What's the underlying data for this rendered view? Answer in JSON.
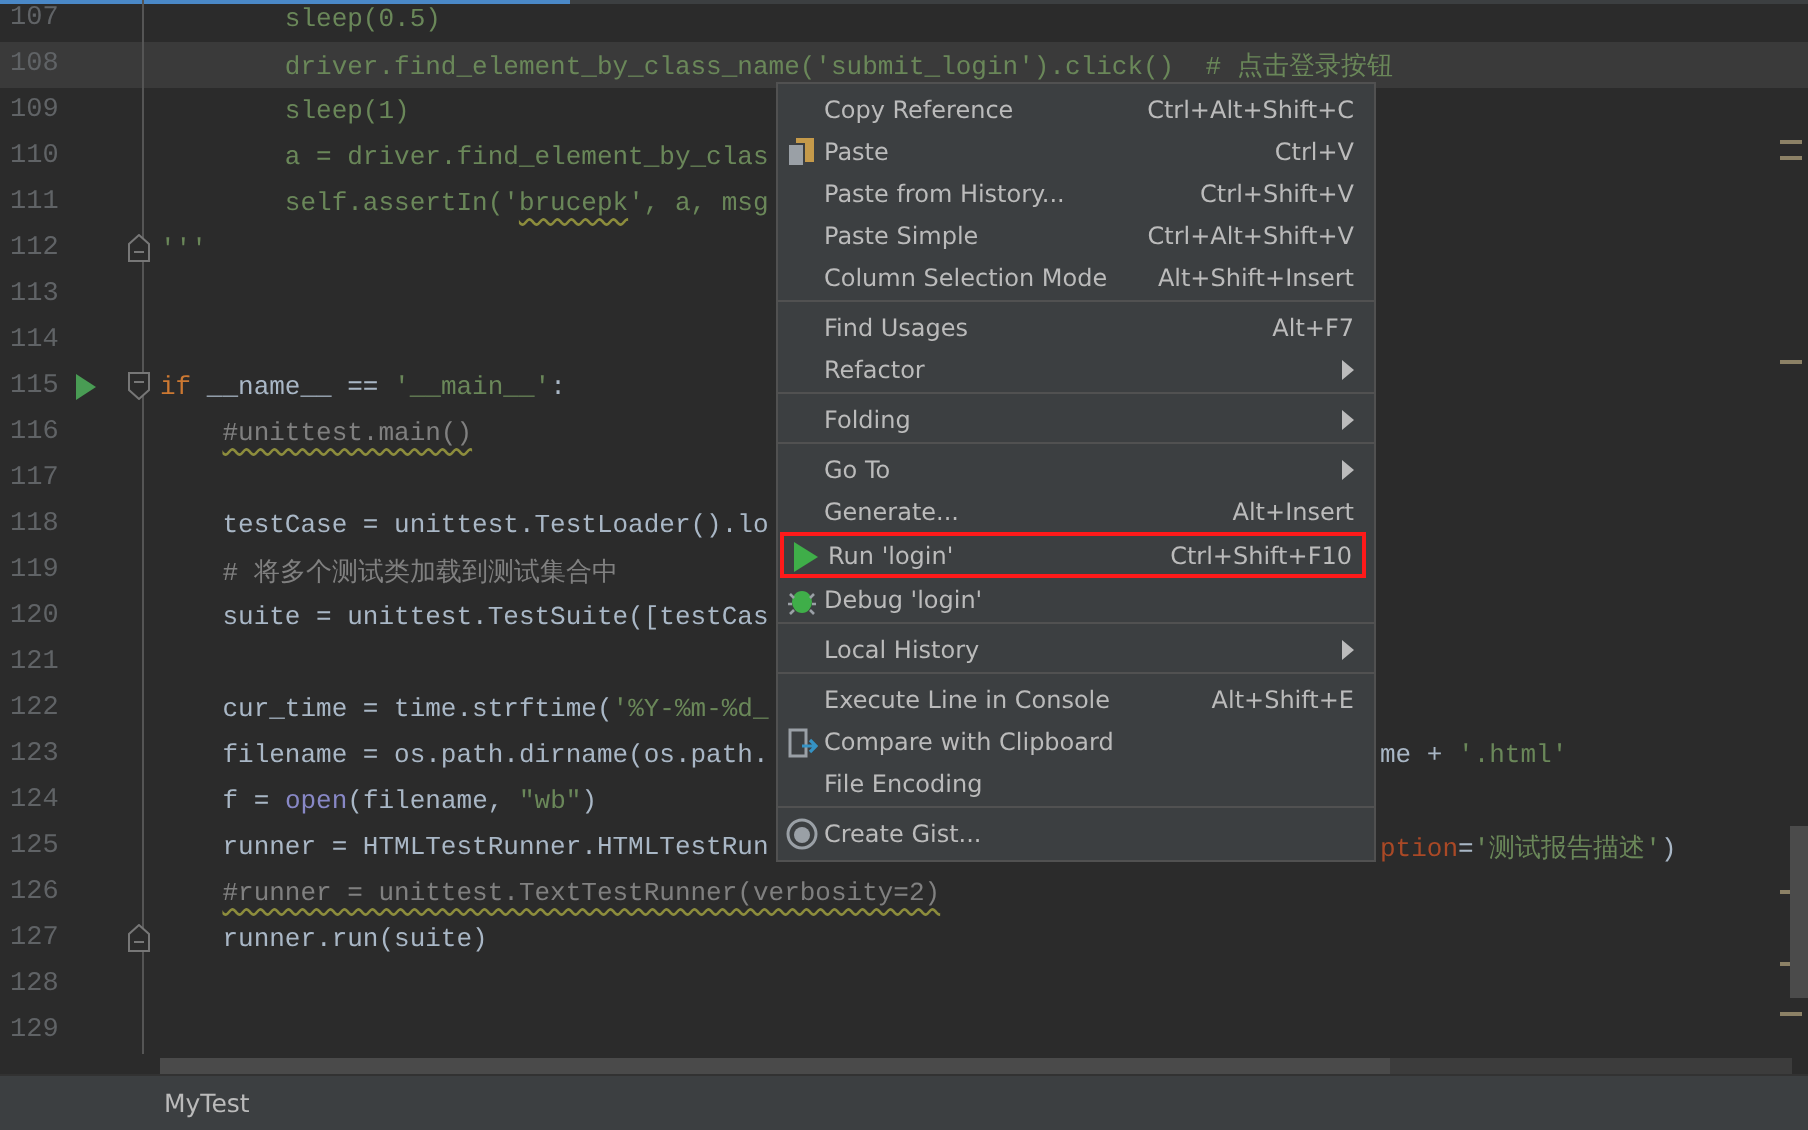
{
  "editor": {
    "lines": [
      {
        "number": "107",
        "segments": [
          {
            "kind": "string",
            "text": "        sleep(0.5)"
          }
        ]
      },
      {
        "number": "108",
        "current": true,
        "segments": [
          {
            "kind": "string",
            "text": "        driver.find_element_by_class_name('submit_login').click()  # 点击登录按钮"
          }
        ]
      },
      {
        "number": "109",
        "segments": [
          {
            "kind": "string",
            "text": "        sleep(1)"
          }
        ]
      },
      {
        "number": "110",
        "segments": [
          {
            "kind": "string",
            "text": "        a = driver.find_element_by_clas"
          }
        ]
      },
      {
        "number": "111",
        "segments": [
          {
            "kind": "string",
            "text": "        self.assertIn('"
          },
          {
            "kind": "string",
            "text": "brucepk",
            "squiggle": true
          },
          {
            "kind": "string",
            "text": "', a, msg"
          }
        ]
      },
      {
        "number": "112",
        "fold_end": true,
        "segments": [
          {
            "kind": "string",
            "text": "'''"
          }
        ]
      },
      {
        "number": "113"
      },
      {
        "number": "114"
      },
      {
        "number": "115",
        "fold_start": true,
        "runnable": true,
        "segments": [
          {
            "kind": "keyword",
            "text": "if"
          },
          {
            "kind": "plain",
            "text": " __name__ == "
          },
          {
            "kind": "string",
            "text": "'__main__'"
          },
          {
            "kind": "plain",
            "text": ":"
          }
        ]
      },
      {
        "number": "116",
        "segments": [
          {
            "kind": "comment",
            "text": "    #unittest.main()",
            "squiggle": true
          }
        ]
      },
      {
        "number": "117"
      },
      {
        "number": "118",
        "segments": [
          {
            "kind": "plain",
            "text": "    testCase = unittest.TestLoader().lo"
          }
        ]
      },
      {
        "number": "119",
        "segments": [
          {
            "kind": "comment",
            "text": "    # 将多个测试类加载到测试集合中"
          }
        ]
      },
      {
        "number": "120",
        "segments": [
          {
            "kind": "plain",
            "text": "    suite = unittest.TestSuite([testCas"
          }
        ]
      },
      {
        "number": "121"
      },
      {
        "number": "122",
        "segments": [
          {
            "kind": "plain",
            "text": "    cur_time = time.strftime("
          },
          {
            "kind": "string",
            "text": "'%Y-%m-%d_"
          }
        ]
      },
      {
        "number": "123",
        "segments": [
          {
            "kind": "plain",
            "text": "    filename = os.path.dirname(os.path."
          }
        ],
        "tail": [
          {
            "kind": "plain",
            "text": "me + "
          },
          {
            "kind": "string",
            "text": "'.html'"
          }
        ]
      },
      {
        "number": "124",
        "segments": [
          {
            "kind": "plain",
            "text": "    f = "
          },
          {
            "kind": "builtin",
            "text": "open"
          },
          {
            "kind": "plain",
            "text": "(filename, "
          },
          {
            "kind": "string",
            "text": "\"wb\""
          },
          {
            "kind": "plain",
            "text": ")"
          }
        ]
      },
      {
        "number": "125",
        "segments": [
          {
            "kind": "plain",
            "text": "    runner = HTMLTestRunner.HTMLTestRun"
          }
        ],
        "tail": [
          {
            "kind": "param",
            "text": "ption"
          },
          {
            "kind": "plain",
            "text": "="
          },
          {
            "kind": "string",
            "text": "'测试报告描述'"
          },
          {
            "kind": "plain",
            "text": ")"
          }
        ]
      },
      {
        "number": "126",
        "segments": [
          {
            "kind": "comment",
            "text": "    #runner = unittest.TextTestRunner(verbosity=2)",
            "squiggle": true
          }
        ]
      },
      {
        "number": "127",
        "fold_end": true,
        "segments": [
          {
            "kind": "plain",
            "text": "    runner.run(suite)"
          }
        ]
      },
      {
        "number": "128"
      },
      {
        "number": "129"
      }
    ]
  },
  "context_menu": {
    "groups": [
      [
        {
          "label": "Copy Reference",
          "shortcut": "Ctrl+Alt+Shift+C",
          "submenu": false,
          "highlighted": false
        },
        {
          "label": "Paste",
          "shortcut": "Ctrl+V",
          "kind": "paste",
          "submenu": false,
          "highlighted": false
        },
        {
          "label": "Paste from History...",
          "shortcut": "Ctrl+Shift+V",
          "submenu": false,
          "highlighted": false
        },
        {
          "label": "Paste Simple",
          "shortcut": "Ctrl+Alt+Shift+V",
          "submenu": false,
          "highlighted": false
        },
        {
          "label": "Column Selection Mode",
          "shortcut": "Alt+Shift+Insert",
          "submenu": false,
          "highlighted": false
        }
      ],
      [
        {
          "label": "Find Usages",
          "shortcut": "Alt+F7",
          "submenu": false,
          "highlighted": false
        },
        {
          "label": "Refactor",
          "submenu": true,
          "highlighted": false
        }
      ],
      [
        {
          "label": "Folding",
          "submenu": true,
          "highlighted": false
        }
      ],
      [
        {
          "label": "Go To",
          "submenu": true,
          "highlighted": false
        },
        {
          "label": "Generate...",
          "shortcut": "Alt+Insert",
          "submenu": false,
          "highlighted": false
        },
        {
          "label": "Run 'login'",
          "shortcut": "Ctrl+Shift+F10",
          "kind": "run",
          "submenu": false,
          "highlighted": true
        },
        {
          "label": "Debug 'login'",
          "kind": "debug",
          "submenu": false,
          "highlighted": false
        }
      ],
      [
        {
          "label": "Local History",
          "submenu": true,
          "highlighted": false
        }
      ],
      [
        {
          "label": "Execute Line in Console",
          "shortcut": "Alt+Shift+E",
          "submenu": false,
          "highlighted": false
        },
        {
          "label": "Compare with Clipboard",
          "kind": "compare",
          "submenu": false,
          "highlighted": false
        },
        {
          "label": "File Encoding",
          "submenu": false,
          "highlighted": false
        }
      ],
      [
        {
          "label": "Create Gist...",
          "kind": "gist",
          "submenu": false,
          "highlighted": false
        }
      ]
    ]
  },
  "status_bar": {
    "breadcrumb": "MyTest"
  }
}
